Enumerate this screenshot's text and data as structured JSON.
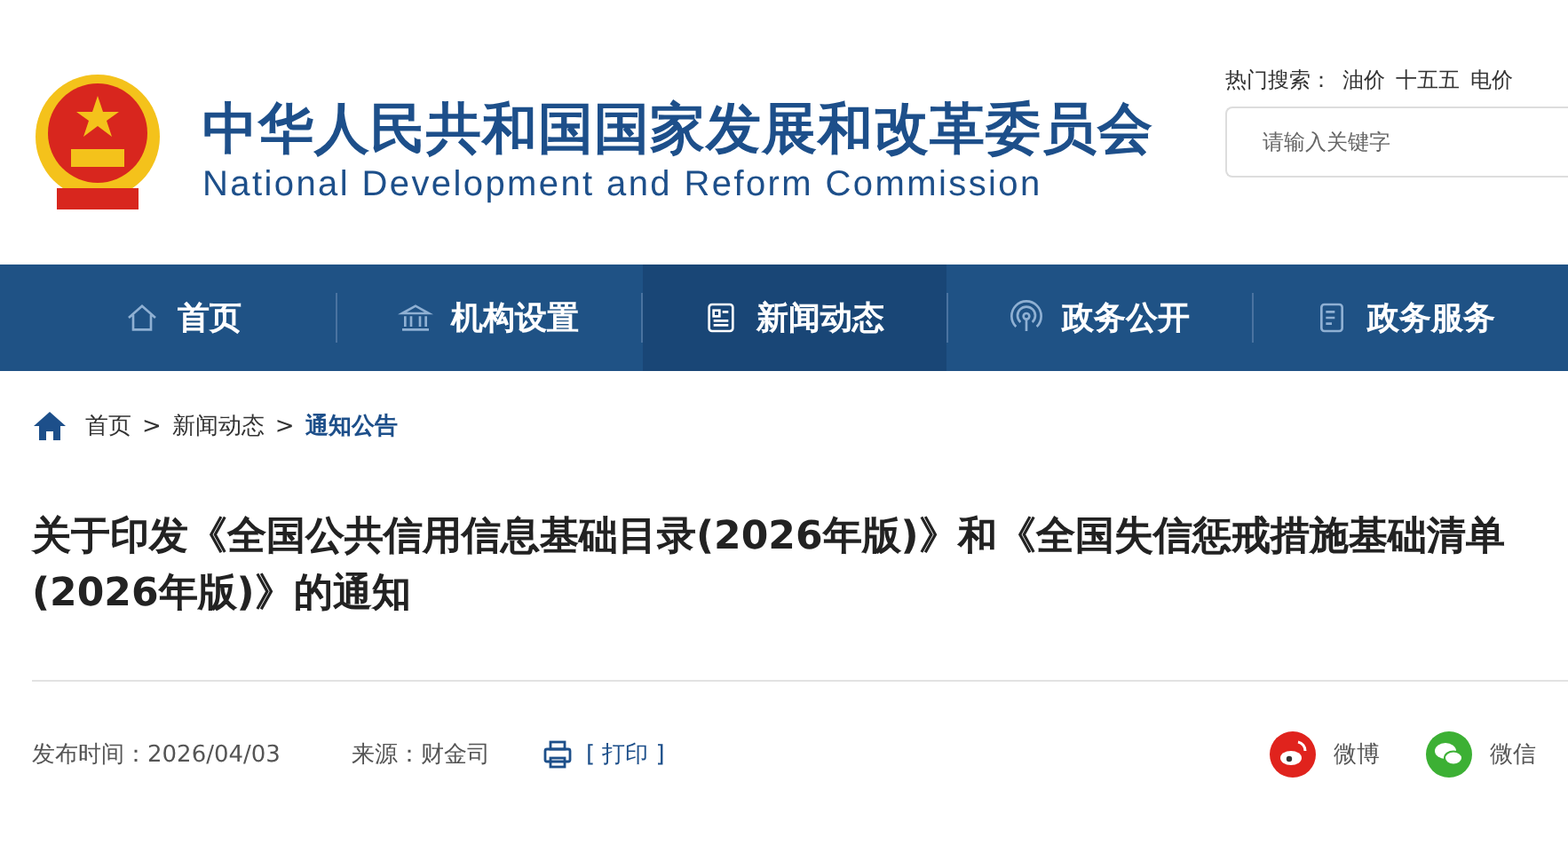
{
  "header": {
    "title_zh": "中华人民共和国国家发展和改革委员会",
    "title_en": "National Development and Reform Commission",
    "hot_search": {
      "label": "热门搜索：",
      "terms": [
        "油价",
        "十五五",
        "电价"
      ]
    },
    "search": {
      "placeholder": "请输入关键字"
    }
  },
  "nav": [
    {
      "label": "首页",
      "kind": "home",
      "selected": false
    },
    {
      "label": "机构设置",
      "kind": "building",
      "selected": false
    },
    {
      "label": "新闻动态",
      "kind": "news",
      "selected": true
    },
    {
      "label": "政务公开",
      "kind": "signal",
      "selected": false
    },
    {
      "label": "政务服务",
      "kind": "doc",
      "selected": false
    }
  ],
  "breadcrumb": [
    {
      "label": "首页",
      "current": false
    },
    {
      "separator": ">",
      "label": "新闻动态",
      "current": false
    },
    {
      "separator": ">",
      "label": "通知公告",
      "current": true
    }
  ],
  "article": {
    "title": "关于印发《全国公共信用信息基础目录(2026年版)》和《全国失信惩戒措施基础清单(2026年版)》的通知",
    "published": "发布时间：2026/04/03",
    "source": "来源：财金司",
    "print": "[ 打印 ]"
  },
  "share": [
    {
      "label": "微博",
      "kind": "weibo",
      "color": "#e0231d"
    },
    {
      "label": "微信",
      "kind": "wechat",
      "color": "#3cb034"
    }
  ]
}
